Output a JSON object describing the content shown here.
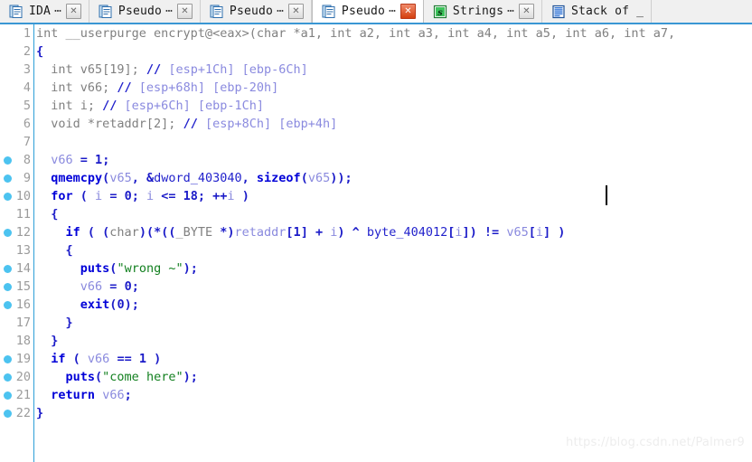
{
  "window": {
    "app": "IDA Pro Pseudocode View",
    "accent_color": "#3a97d4",
    "background": "#ffffff"
  },
  "tabbar": {
    "tabs": [
      {
        "label": "IDA",
        "ellipsis": "⋯",
        "icon": "document-blue-icon",
        "active": false,
        "close_label": "✕",
        "close_hot": false
      },
      {
        "label": "Pseudo",
        "ellipsis": "⋯",
        "icon": "document-blue-icon",
        "active": false,
        "close_label": "✕",
        "close_hot": false
      },
      {
        "label": "Pseudo",
        "ellipsis": "⋯",
        "icon": "document-blue-icon",
        "active": false,
        "close_label": "✕",
        "close_hot": false
      },
      {
        "label": "Pseudo",
        "ellipsis": "⋯",
        "icon": "document-blue-icon",
        "active": true,
        "close_label": "✕",
        "close_hot": true
      },
      {
        "label": "Strings",
        "ellipsis": "⋯",
        "icon": "strings-green-icon",
        "active": false,
        "close_label": "✕",
        "close_hot": false
      },
      {
        "label": "Stack of _",
        "ellipsis": "",
        "icon": "stack-blue-icon",
        "active": false,
        "close_label": "",
        "close_hot": false
      }
    ]
  },
  "editor": {
    "caret_visible": true,
    "breakpoint_color": "#4cc3f0",
    "gutter_rule_color": "#2d9fd8",
    "lineno_color": "#9b9b9b",
    "lines": [
      {
        "n": "1",
        "bp": false
      },
      {
        "n": "2",
        "bp": false
      },
      {
        "n": "3",
        "bp": false
      },
      {
        "n": "4",
        "bp": false
      },
      {
        "n": "5",
        "bp": false
      },
      {
        "n": "6",
        "bp": false
      },
      {
        "n": "7",
        "bp": false
      },
      {
        "n": "8",
        "bp": true
      },
      {
        "n": "9",
        "bp": true
      },
      {
        "n": "10",
        "bp": true
      },
      {
        "n": "11",
        "bp": false
      },
      {
        "n": "12",
        "bp": true
      },
      {
        "n": "13",
        "bp": false
      },
      {
        "n": "14",
        "bp": true
      },
      {
        "n": "15",
        "bp": true
      },
      {
        "n": "16",
        "bp": true
      },
      {
        "n": "17",
        "bp": false
      },
      {
        "n": "18",
        "bp": false
      },
      {
        "n": "19",
        "bp": true
      },
      {
        "n": "20",
        "bp": true
      },
      {
        "n": "21",
        "bp": true
      },
      {
        "n": "22",
        "bp": true
      }
    ],
    "code_plain": [
      "int __userpurge encrypt@<eax>(char *a1, int a2, int a3, int a4, int a5, int a6, int a7,",
      "{",
      "  int v65[19]; // [esp+1Ch] [ebp-6Ch]",
      "  int v66; // [esp+68h] [ebp-20h]",
      "  int i; // [esp+6Ch] [ebp-1Ch]",
      "  void *retaddr[2]; // [esp+8Ch] [ebp+4h]",
      "",
      "  v66 = 1;",
      "  qmemcpy(v65, &dword_403040, sizeof(v65));",
      "  for ( i = 0; i <= 18; ++i )",
      "  {",
      "    if ( (char)(*((_BYTE *)retaddr[1] + i) ^ byte_404012[i]) != v65[i] )",
      "    {",
      "      puts(\"wrong ~\");",
      "      v66 = 0;",
      "      exit(0);",
      "    }",
      "  }",
      "  if ( v66 == 1 )",
      "    puts(\"come here\");",
      "  return v66;",
      "}"
    ]
  },
  "watermark": {
    "text": "https://blog.csdn.net/Palmer9"
  }
}
